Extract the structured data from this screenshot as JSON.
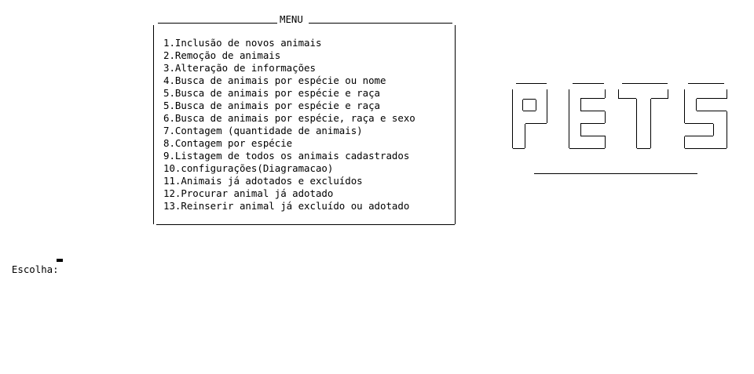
{
  "menu": {
    "title": "MENU",
    "items": [
      "1.Inclusão de novos animais",
      "2.Remoção de animais",
      "3.Alteração de informações",
      "4.Busca de animais por espécie ou nome",
      "5.Busca de animais por espécie e raça",
      "5.Busca de animais por espécie e raça",
      "6.Busca de animais por espécie, raça e sexo",
      "7.Contagem (quantidade de animais)",
      "8.Contagem por espécie",
      "9.Listagem de todos os animais cadastrados",
      "10.configurações(Diagramacao)",
      "11.Animais já adotados e excluídos",
      "12.Procurar animal já adotado",
      "13.Reinserir animal já excluído ou adotado"
    ]
  },
  "logo": {
    "text": "PETS"
  },
  "prompt": {
    "label": "Escolha: ",
    "value": ""
  }
}
